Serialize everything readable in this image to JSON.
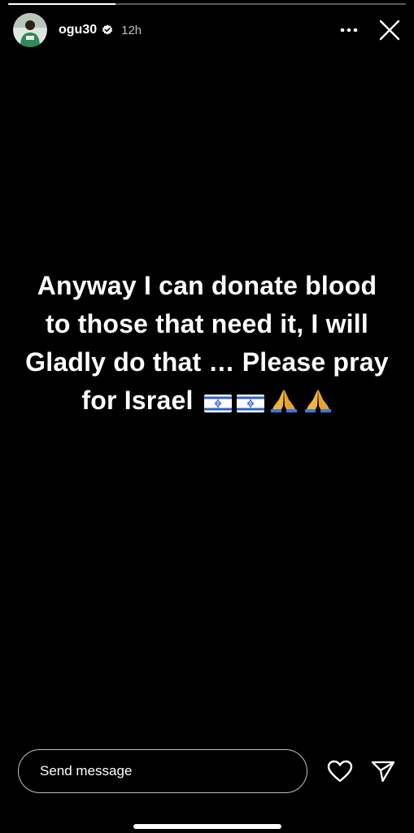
{
  "story": {
    "progress_fraction": 0.27,
    "username": "ogu30",
    "timestamp": "12h",
    "text": "Anyway I can donate blood to those that need it, I will Gladly do that … Please pray for Israel",
    "emojis": [
      "israel-flag",
      "israel-flag",
      "folded-hands",
      "folded-hands"
    ]
  },
  "footer": {
    "message_placeholder": "Send message"
  },
  "icons": {
    "more": "more-horizontal-icon",
    "close": "close-icon",
    "verified": "verified-badge-icon",
    "like": "heart-icon",
    "share": "send-icon"
  },
  "colors": {
    "background": "#000000",
    "text": "#ffffff",
    "flag_blue": "#2e63c7",
    "hands": "#f2b33d"
  }
}
